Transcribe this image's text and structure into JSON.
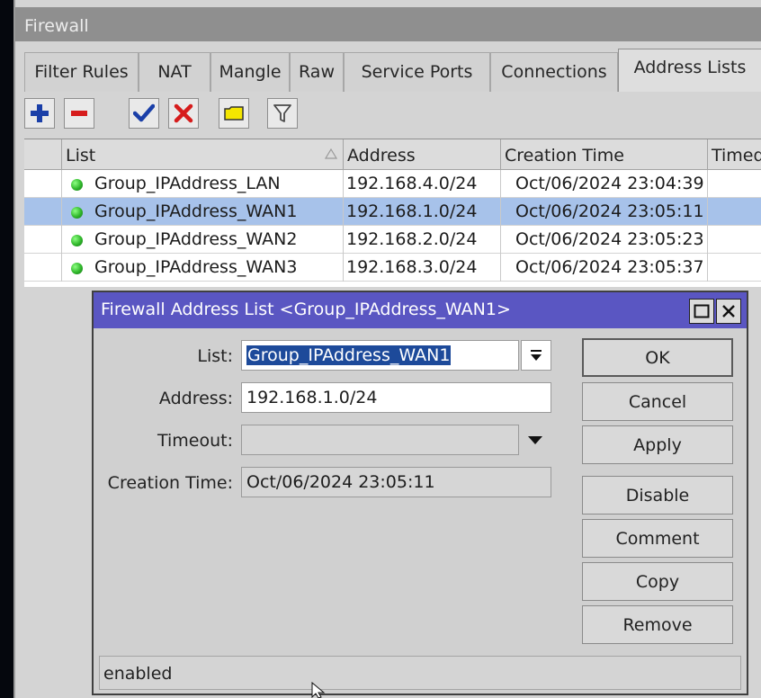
{
  "window": {
    "title": "Firewall"
  },
  "tabs": [
    {
      "label": "Filter Rules"
    },
    {
      "label": "NAT"
    },
    {
      "label": "Mangle"
    },
    {
      "label": "Raw"
    },
    {
      "label": "Service Ports"
    },
    {
      "label": "Connections"
    },
    {
      "label": "Address Lists",
      "active": true
    }
  ],
  "toolbar": {
    "buttons": [
      {
        "name": "add",
        "icon": "plus-icon",
        "color": "#1a3fa8"
      },
      {
        "name": "remove",
        "icon": "minus-icon",
        "color": "#d61c1c"
      },
      {
        "name": "enable",
        "icon": "check-icon",
        "color": "#1a3fa8"
      },
      {
        "name": "disable",
        "icon": "x-icon",
        "color": "#d61c1c"
      },
      {
        "name": "comment",
        "icon": "note-icon",
        "color": "#f4e600"
      },
      {
        "name": "filter",
        "icon": "filter-icon",
        "color": "#4a4a4a"
      }
    ]
  },
  "table": {
    "columns": [
      {
        "label": "List",
        "sort": "ascending"
      },
      {
        "label": "Address"
      },
      {
        "label": "Creation Time"
      },
      {
        "label": "Timed"
      }
    ],
    "rows": [
      {
        "status": "enabled",
        "list": "Group_IPAddress_LAN",
        "address": "192.168.4.0/24",
        "creation_time": "Oct/06/2024 23:04:39"
      },
      {
        "status": "enabled",
        "list": "Group_IPAddress_WAN1",
        "address": "192.168.1.0/24",
        "creation_time": "Oct/06/2024 23:05:11",
        "selected": true
      },
      {
        "status": "enabled",
        "list": "Group_IPAddress_WAN2",
        "address": "192.168.2.0/24",
        "creation_time": "Oct/06/2024 23:05:23"
      },
      {
        "status": "enabled",
        "list": "Group_IPAddress_WAN3",
        "address": "192.168.3.0/24",
        "creation_time": "Oct/06/2024 23:05:37"
      }
    ]
  },
  "dialog": {
    "title": "Firewall Address List <Group_IPAddress_WAN1>",
    "fields": {
      "list_label": "List:",
      "list_value": "Group_IPAddress_WAN1",
      "address_label": "Address:",
      "address_value": "192.168.1.0/24",
      "timeout_label": "Timeout:",
      "timeout_value": "",
      "creation_label": "Creation Time:",
      "creation_value": "Oct/06/2024 23:05:11"
    },
    "buttons": {
      "ok": "OK",
      "cancel": "Cancel",
      "apply": "Apply",
      "disable": "Disable",
      "comment": "Comment",
      "copy": "Copy",
      "remove": "Remove"
    },
    "status": "enabled"
  },
  "colors": {
    "dialog_title_bg": "#5a56c2",
    "selected_row_bg": "#a7c2ea",
    "status_dot": "#2fb62a",
    "text_selection_bg": "#1d4a9a"
  }
}
